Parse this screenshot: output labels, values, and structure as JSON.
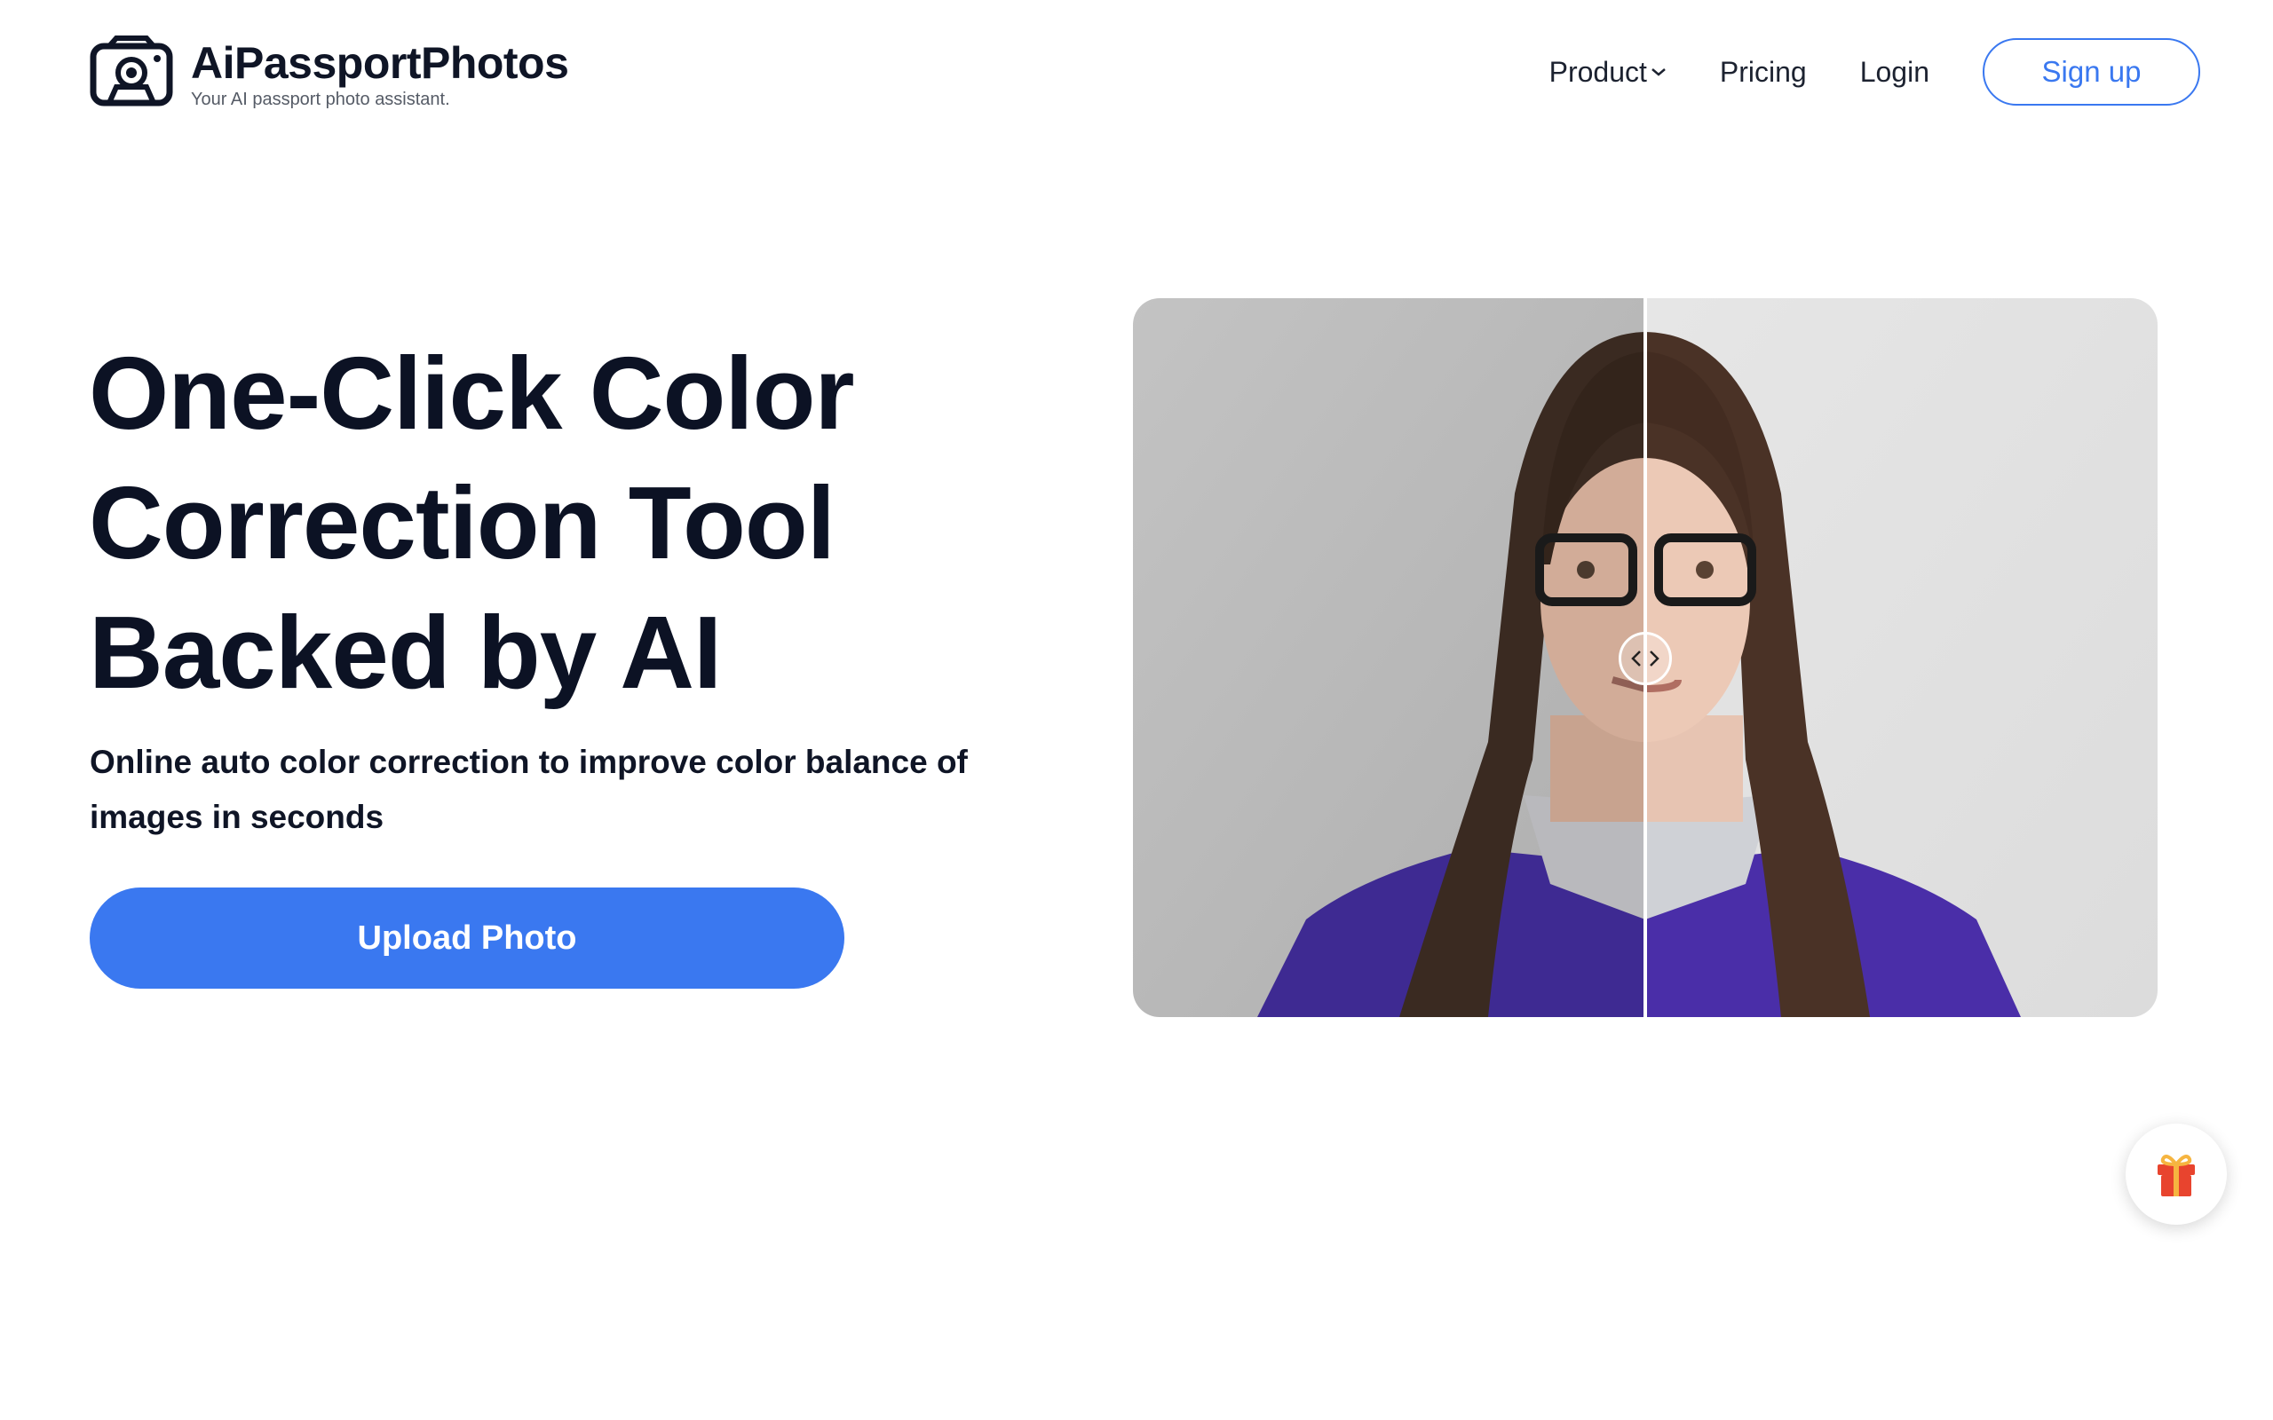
{
  "brand": {
    "name": "AiPassportPhotos",
    "tagline": "Your AI passport photo assistant."
  },
  "nav": {
    "product": "Product",
    "pricing": "Pricing",
    "login": "Login",
    "signup": "Sign up"
  },
  "hero": {
    "title_line1": "One-Click Color",
    "title_line2": "Correction Tool",
    "title_line3": "Backed by AI",
    "subtitle": "Online auto color correction to improve color balance of images in seconds",
    "upload_button": "Upload Photo"
  },
  "compare": {
    "split_position": 0.5
  },
  "icons": {
    "logo": "camera-icon",
    "product_dropdown": "chevron-down-icon",
    "compare_handle": "left-right-arrows-icon",
    "floating": "gift-icon"
  },
  "colors": {
    "accent": "#3a78f0",
    "text_dark": "#0c1224",
    "gift_red": "#e8442e"
  }
}
